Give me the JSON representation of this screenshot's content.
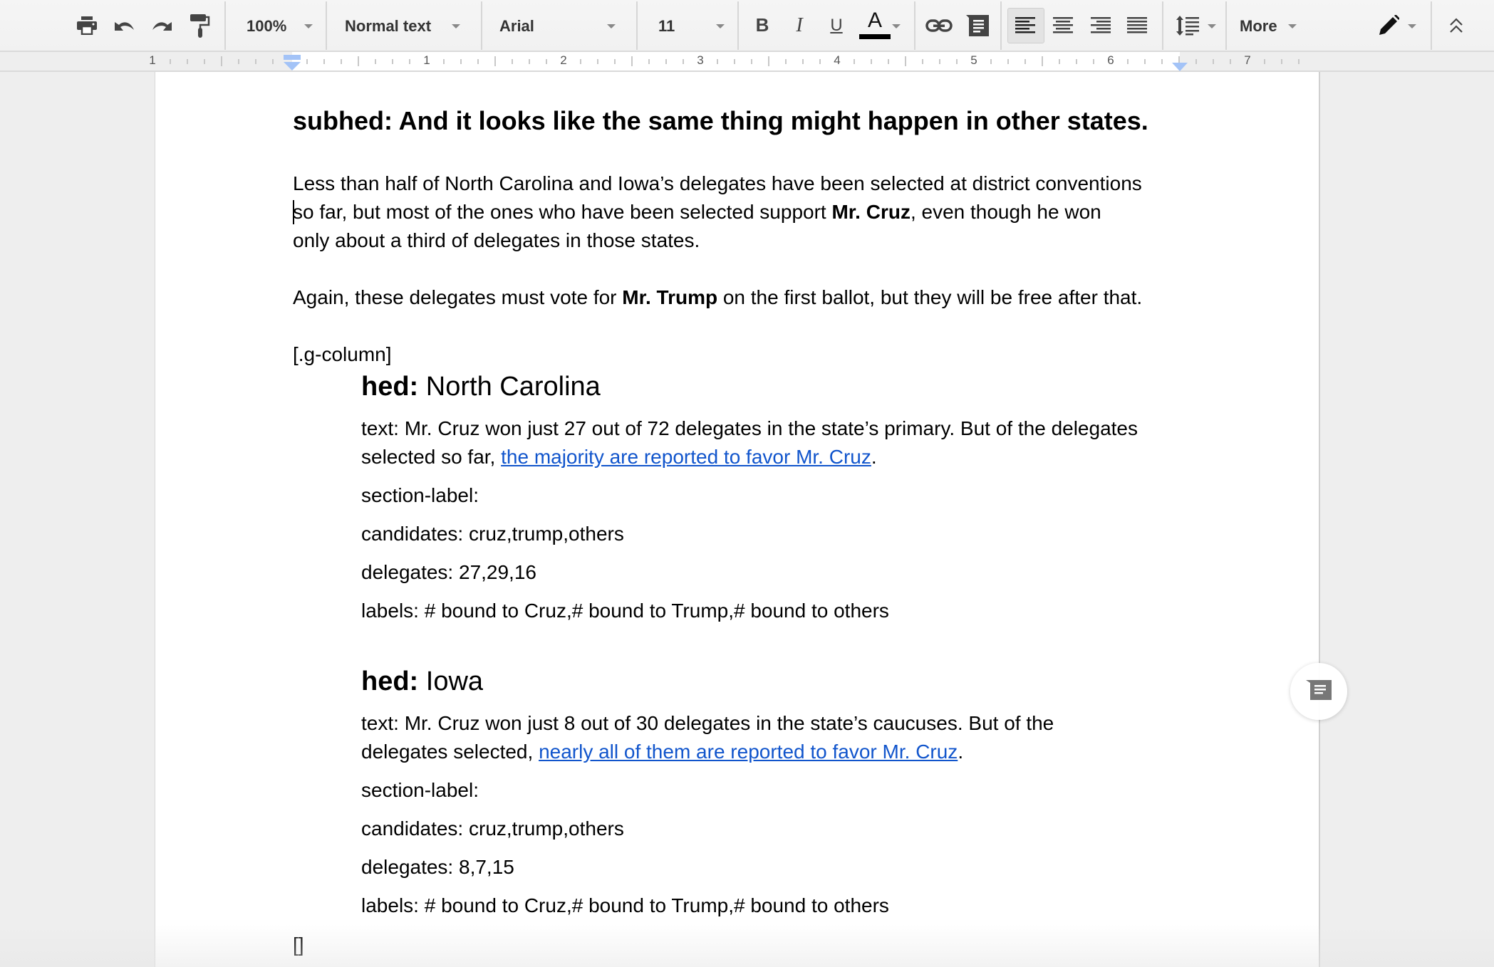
{
  "toolbar": {
    "zoom": "100%",
    "style": "Normal text",
    "font": "Arial",
    "font_size": "11",
    "more_label": "More",
    "text_color": "#000000",
    "icons": [
      "print-icon",
      "undo-icon",
      "redo-icon",
      "paint-format-icon",
      "bold-icon",
      "italic-icon",
      "underline-icon",
      "text-color-icon",
      "link-icon",
      "comment-icon",
      "align-left-icon",
      "align-center-icon",
      "align-right-icon",
      "align-justify-icon",
      "line-spacing-icon",
      "pencil-icon",
      "collapse-icon"
    ],
    "bold_glyph": "B",
    "italic_glyph": "I",
    "underline_glyph": "U",
    "color_glyph": "A"
  },
  "ruler": {
    "numbers": [
      "1",
      "1",
      "2",
      "3",
      "4",
      "5",
      "6",
      "7"
    ]
  },
  "document": {
    "subhed": "subhed: And it looks like the same thing might happen in other states.",
    "para1": {
      "line1": "Less than half of North Carolina and Iowa’s delegates have been selected at district conventions",
      "line2_pre": "so far, but most of the ones who have been selected support ",
      "line2_bold": "Mr. Cruz",
      "line2_post": ", even though he won",
      "line3": "only about a third of delegates in those states."
    },
    "para2": {
      "pre": "Again, these delegates must vote for ",
      "bold": "Mr. Trump",
      "post": " on the first ballot, but they will be free after that."
    },
    "column_open": "[.g-column]",
    "sections": [
      {
        "hed_key": "hed:",
        "hed_value": " North Carolina",
        "text_line1": "text: Mr. Cruz won just 27 out of 72 delegates in the state’s primary. But of the delegates",
        "text_line2_pre": "selected so far, ",
        "text_link": "the majority are reported to favor Mr. Cruz",
        "text_line2_post": ".",
        "section_label": "section-label:",
        "candidates": "candidates: cruz,trump,others",
        "delegates": "delegates: 27,29,16",
        "labels": "labels: # bound to Cruz,# bound to Trump,# bound to others"
      },
      {
        "hed_key": "hed:",
        "hed_value": " Iowa",
        "text_line1": "text: Mr. Cruz won just 8 out of 30 delegates in the state’s caucuses. But of the",
        "text_line2_pre": "delegates selected, ",
        "text_link": "nearly all of them are reported to favor Mr. Cruz",
        "text_line2_post": ".",
        "section_label": "section-label:",
        "candidates": "candidates: cruz,trump,others",
        "delegates": "delegates: 8,7,15",
        "labels": "labels: # bound to Cruz,# bound to Trump,# bound to others"
      }
    ],
    "column_close": "[]"
  },
  "colors": {
    "link": "#1155cc",
    "ruler_marker": "#a3c3f7",
    "toolbar_bg": "#f1f1f1",
    "canvas_bg": "#eeeeee"
  }
}
